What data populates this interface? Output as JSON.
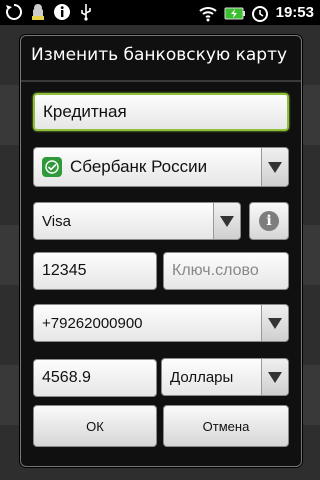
{
  "status_bar": {
    "time": "19:53",
    "icons_left": [
      "sync-icon",
      "android-robot-icon",
      "info-icon",
      "usb-icon"
    ],
    "icons_right": [
      "wifi-icon",
      "battery-charging-icon",
      "alarm-icon"
    ]
  },
  "dialog": {
    "title": "Изменить банковскую карту",
    "card_name": "Кредитная",
    "bank": {
      "label": "Сбербанк России",
      "icon": "sberbank-logo-icon"
    },
    "card_type": "Visa",
    "card_number": "12345",
    "keyword_placeholder": "Ключ.слово",
    "phone": "+79262000900",
    "amount": "4568.9",
    "currency": "Доллары",
    "ok_label": "ОК",
    "cancel_label": "Отмена"
  },
  "colors": {
    "focus_accent": "#8fbf3a",
    "bank_logo": "#2f9a3a",
    "dialog_bg": "#101010"
  }
}
